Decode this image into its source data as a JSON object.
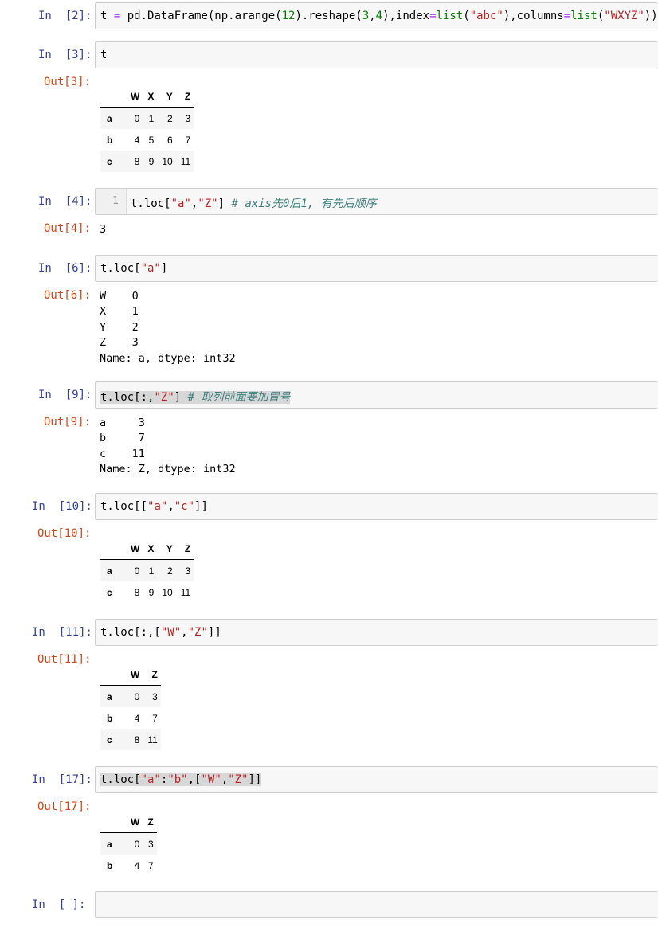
{
  "cells": [
    {
      "in_prompt": "In  [2]:",
      "code": "t = pd.DataFrame(np.arange(12).reshape(3,4),index=list(\"abc\"),columns=list(\"WXYZ\"))"
    },
    {
      "in_prompt": "In  [3]:",
      "code": "t",
      "out_prompt": "Out[3]:",
      "table": {
        "columns": [
          "W",
          "X",
          "Y",
          "Z"
        ],
        "rows": [
          [
            "a",
            "0",
            "1",
            "2",
            "3"
          ],
          [
            "b",
            "4",
            "5",
            "6",
            "7"
          ],
          [
            "c",
            "8",
            "9",
            "10",
            "11"
          ]
        ]
      }
    },
    {
      "in_prompt": "In  [4]:",
      "line_number": "1",
      "code_main": "t.loc[\"a\",\"Z\"]",
      "code_comment": "# axis先0后1, 有先后顺序",
      "out_prompt": "Out[4]:",
      "output": "3"
    },
    {
      "in_prompt": "In  [6]:",
      "code": "t.loc[\"a\"]",
      "out_prompt": "Out[6]:",
      "output": "W    0\nX    1\nY    2\nZ    3\nName: a, dtype: int32"
    },
    {
      "in_prompt": "In  [9]:",
      "code_main": "t.loc[:,\"Z\"]",
      "code_comment": "# 取列前面要加冒号",
      "out_prompt": "Out[9]:",
      "output": "a     3\nb     7\nc    11\nName: Z, dtype: int32"
    },
    {
      "in_prompt": "In  [10]:",
      "code": "t.loc[[\"a\",\"c\"]]",
      "out_prompt": "Out[10]:",
      "table": {
        "columns": [
          "W",
          "X",
          "Y",
          "Z"
        ],
        "rows": [
          [
            "a",
            "0",
            "1",
            "2",
            "3"
          ],
          [
            "c",
            "8",
            "9",
            "10",
            "11"
          ]
        ]
      }
    },
    {
      "in_prompt": "In  [11]:",
      "code": "t.loc[:,[\"W\",\"Z\"]]",
      "out_prompt": "Out[11]:",
      "table": {
        "columns": [
          "W",
          "Z"
        ],
        "rows": [
          [
            "a",
            "0",
            "3"
          ],
          [
            "b",
            "4",
            "7"
          ],
          [
            "c",
            "8",
            "11"
          ]
        ]
      }
    },
    {
      "in_prompt": "In  [17]:",
      "code": "t.loc[\"a\":\"b\",[\"W\",\"Z\"]]",
      "out_prompt": "Out[17]:",
      "table": {
        "columns": [
          "W",
          "Z"
        ],
        "rows": [
          [
            "a",
            "0",
            "3"
          ],
          [
            "b",
            "4",
            "7"
          ]
        ]
      }
    },
    {
      "in_prompt": "In  [ ]:",
      "code": ""
    }
  ]
}
